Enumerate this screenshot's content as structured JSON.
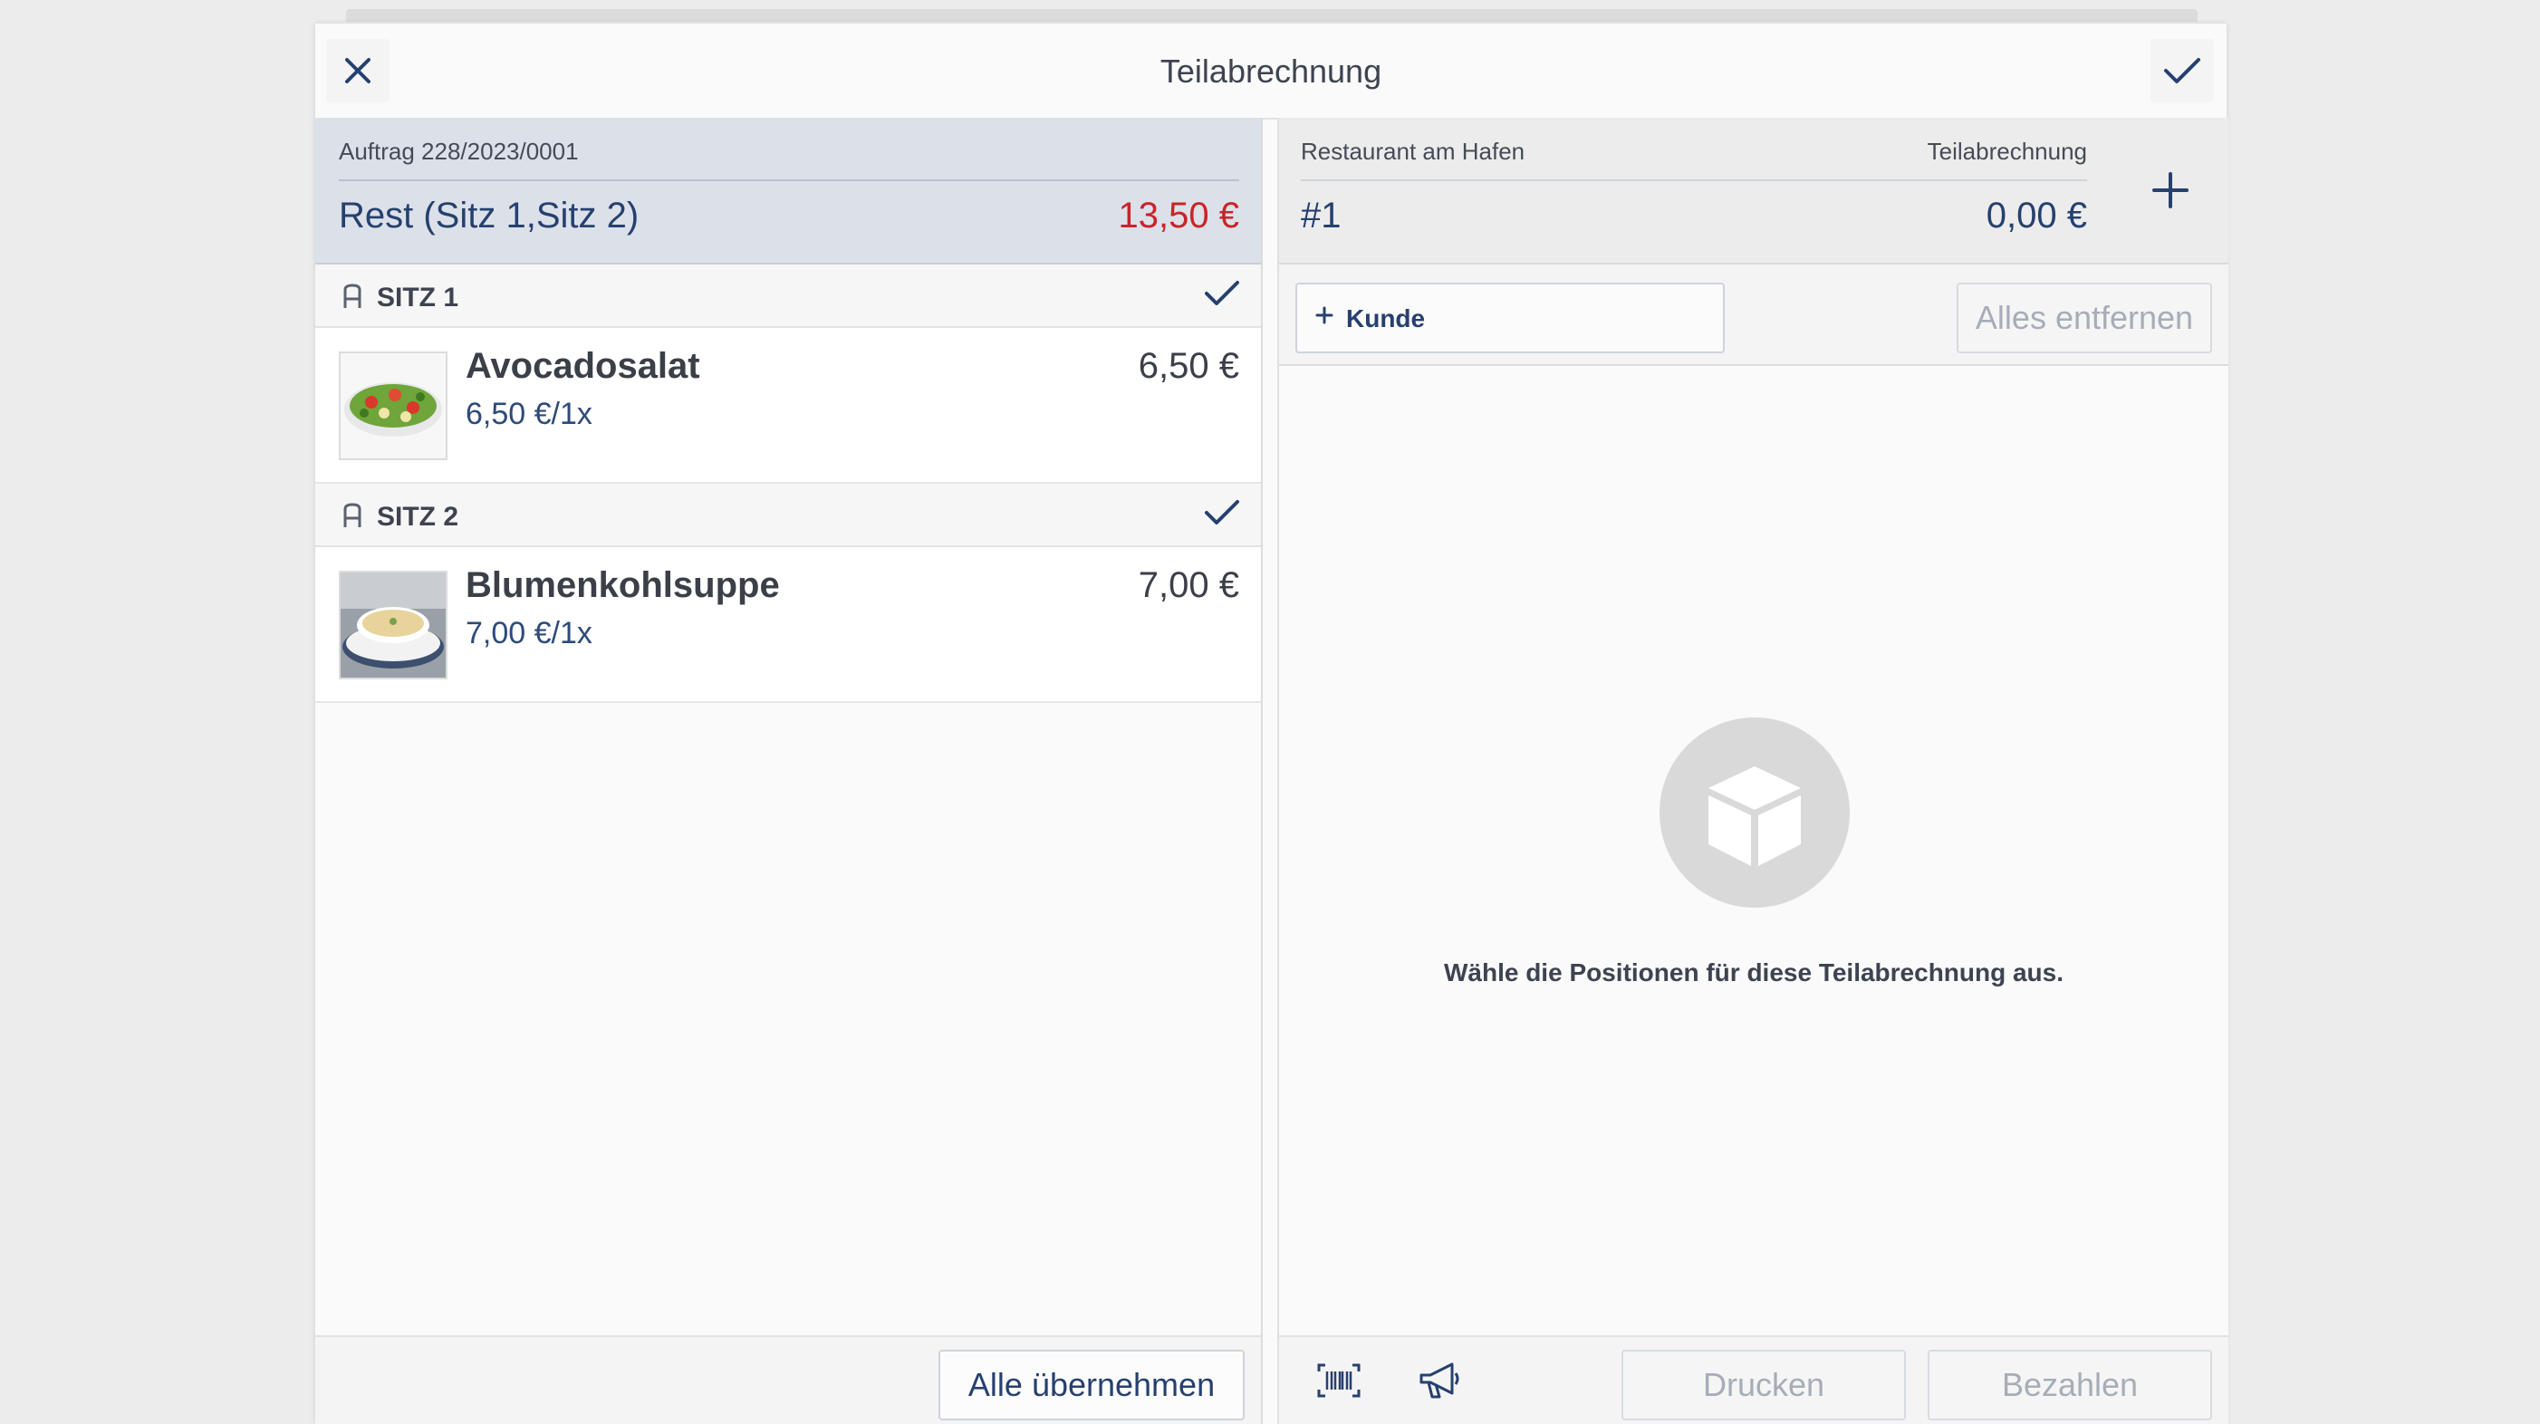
{
  "dialog": {
    "title": "Teilabrechnung",
    "close_icon": "close-icon",
    "confirm_icon": "check-icon"
  },
  "order": {
    "number_label": "Auftrag 228/2023/0001",
    "name": "Rest (Sitz 1,Sitz 2)",
    "total": "13,50 €",
    "total_color": "#c9242a"
  },
  "seats": [
    {
      "label": "SITZ 1",
      "items": [
        {
          "name": "Avocadosalat",
          "unit_price": "6,50 €/1x",
          "price": "6,50 €",
          "image": "salad-image"
        }
      ]
    },
    {
      "label": "SITZ 2",
      "items": [
        {
          "name": "Blumenkohlsuppe",
          "unit_price": "7,00 €/1x",
          "price": "7,00 €",
          "image": "soup-image"
        }
      ]
    }
  ],
  "left_footer": {
    "take_all_label": "Alle übernehmen"
  },
  "split": {
    "venue": "Restaurant am Hafen",
    "type_label": "Teilabrechnung",
    "number": "#1",
    "total": "0,00 €",
    "add_customer_label": "Kunde",
    "remove_all_label": "Alles entfernen",
    "empty_message": "Wähle die Positionen für diese Teilabrechnung aus."
  },
  "right_footer": {
    "print_label": "Drucken",
    "pay_label": "Bezahlen",
    "icons": [
      "barcode-icon",
      "megaphone-icon"
    ]
  },
  "colors": {
    "accent": "#26406f",
    "header_bg": "#dce1e9",
    "negative": "#c9242a"
  }
}
